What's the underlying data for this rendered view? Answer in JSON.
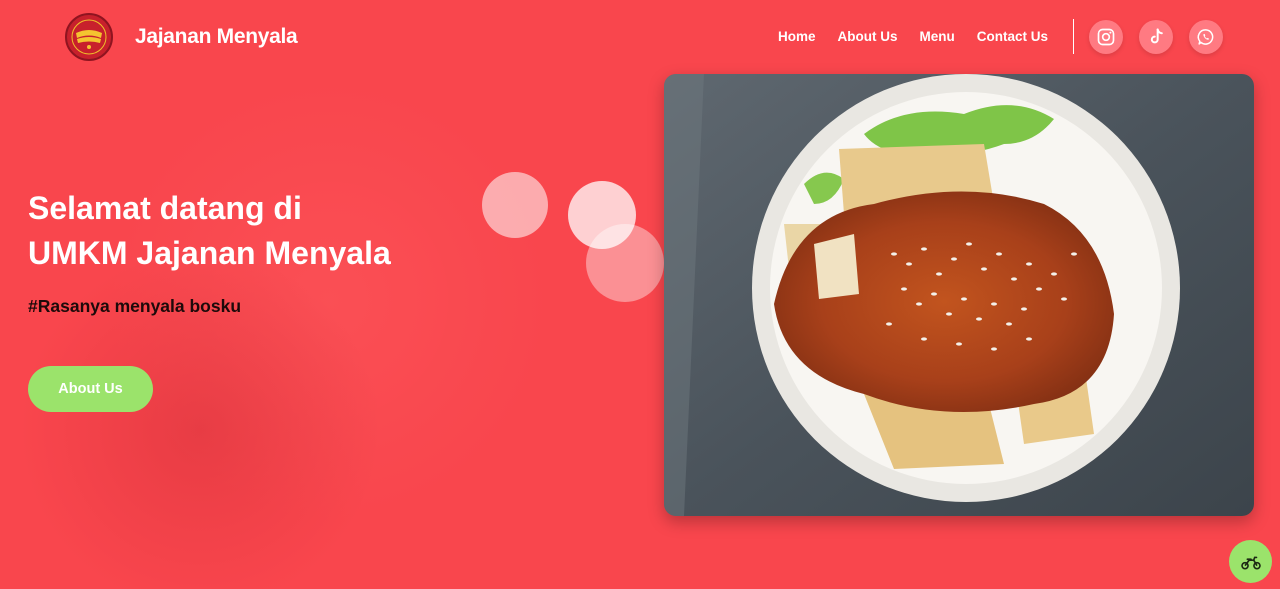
{
  "header": {
    "brand": "Jajanan Menyala",
    "logo_icon": "brand-logo-icon",
    "nav": [
      {
        "label": "Home"
      },
      {
        "label": "About Us"
      },
      {
        "label": "Menu"
      },
      {
        "label": "Contact Us"
      }
    ],
    "social": [
      {
        "icon": "instagram-icon"
      },
      {
        "icon": "tiktok-icon"
      },
      {
        "icon": "whatsapp-icon"
      }
    ]
  },
  "hero": {
    "title_line1": "Selamat datang di",
    "title_line2": "UMKM Jajanan Menyala",
    "tagline": "#Rasanya menyala bosku",
    "cta_label": "About Us",
    "image_icon": "food-bowl-image"
  },
  "floating": {
    "icon": "motorbike-icon"
  },
  "colors": {
    "background": "#f9464d",
    "accent_green": "#9be36b",
    "text_white": "#ffffff",
    "social_circle": "#ff7a82"
  }
}
